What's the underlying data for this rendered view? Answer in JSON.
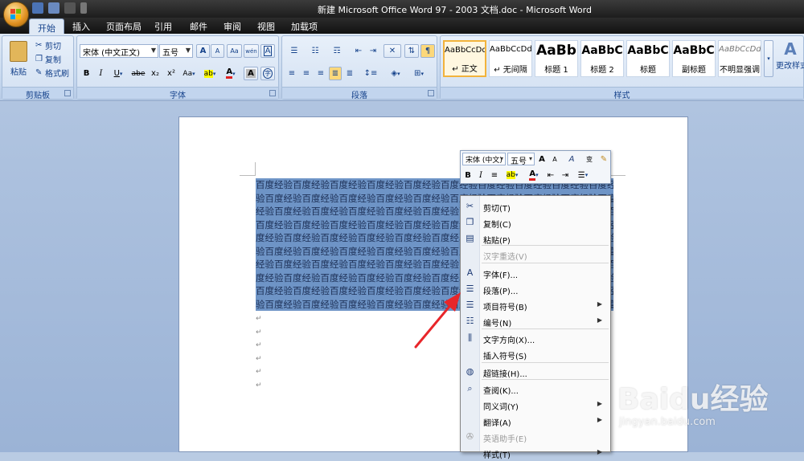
{
  "window": {
    "title": "新建 Microsoft Office Word 97 - 2003 文档.doc - Microsoft Word"
  },
  "tabs": [
    "开始",
    "插入",
    "页面布局",
    "引用",
    "邮件",
    "审阅",
    "视图",
    "加载项"
  ],
  "clipboard": {
    "paste": "粘贴",
    "cut": "剪切",
    "copy": "复制",
    "format_painter": "格式刷",
    "group": "剪贴板"
  },
  "font": {
    "name": "宋体 (中文正文)",
    "size": "五号",
    "group": "字体",
    "grow": "A",
    "shrink": "A",
    "clear": "Aa",
    "phonetic": "wén",
    "border_char": "A",
    "bold": "B",
    "italic": "I",
    "underline": "U",
    "strike": "abe",
    "subscript": "x₂",
    "superscript": "x²",
    "change_case": "Aa",
    "highlight": "ab",
    "font_color": "A",
    "char_shade": "A",
    "enclose": "字"
  },
  "paragraph": {
    "group": "段落"
  },
  "styles": {
    "group": "样式",
    "items": [
      {
        "preview": "AaBbCcDd",
        "name": "↵ 正文"
      },
      {
        "preview": "AaBbCcDd",
        "name": "↵ 无间隔"
      },
      {
        "preview": "AaBb",
        "name": "标题 1"
      },
      {
        "preview": "AaBbC",
        "name": "标题 2"
      },
      {
        "preview": "AaBbC",
        "name": "标题"
      },
      {
        "preview": "AaBbC",
        "name": "副标题"
      },
      {
        "preview": "AaBbCcDd",
        "name": "不明显强调"
      }
    ],
    "change_styles": "更改样式"
  },
  "document": {
    "lines": [
      "百度经验百度经验百度经验百度经验百度经验百度经验百度经验百度经验百度经验百度经验",
      "验百度经验百度经验百度经验百度经验百度经验百度经验百度经验百度经验百度经验百度经验",
      "经验百度经验百度经验百度经验百度经验百度经验百度经验百度经验百度经验百度经验百度",
      "百度经验百度经验百度经验百度经验百度经验百度经验百度经验百度经验百度经验百度经验",
      "度经验百度经验百度经验百度经验百度经验百度经验百度经验百度经验百度经验百度经验百",
      "验百度经验百度经验百度经验百度经验百度经验百度经验百度经验百度经验百度经验百度经",
      "经验百度经验百度经验百度经验百度经验百度经验百度经验百度经验百度经验百度经验百度",
      "度经验百度经验百度经验百度经验百度经验百度经验百度经验百度经验百度经验百度经验百",
      "百度经验百度经验百度经验百度经验百度经验百度经验百度经验百度经验百度经验百度经验",
      "验百度经验百度经验百度经验百度经验百度经验百度经验百度经验百度经验百度经验百度经"
    ],
    "empty_marks": [
      "↵",
      "↵",
      "↵",
      "↵",
      "↵",
      "↵"
    ]
  },
  "mini_toolbar": {
    "font": "宋体 (中文)",
    "size": "五号",
    "bold": "B",
    "italic": "I",
    "font_color": "A"
  },
  "context_menu": {
    "items": [
      {
        "label": "剪切(T)",
        "icon": "scissors-icon"
      },
      {
        "label": "复制(C)",
        "icon": "copy-icon"
      },
      {
        "label": "粘贴(P)",
        "icon": "paste-icon"
      },
      {
        "label": "汉字重选(V)",
        "icon": "",
        "disabled": true
      },
      {
        "label": "字体(F)...",
        "icon": "font-icon"
      },
      {
        "label": "段落(P)...",
        "icon": "paragraph-icon"
      },
      {
        "label": "项目符号(B)",
        "icon": "bullets-icon",
        "submenu": true
      },
      {
        "label": "编号(N)",
        "icon": "numbering-icon",
        "submenu": true
      },
      {
        "label": "文字方向(X)...",
        "icon": "text-direction-icon"
      },
      {
        "label": "插入符号(S)",
        "icon": ""
      },
      {
        "label": "超链接(H)...",
        "icon": "hyperlink-icon"
      },
      {
        "label": "查阅(K)...",
        "icon": "lookup-icon"
      },
      {
        "label": "同义词(Y)",
        "icon": "",
        "submenu": true
      },
      {
        "label": "翻译(A)",
        "icon": "",
        "submenu": true
      },
      {
        "label": "英语助手(E)",
        "icon": "assistant-icon",
        "disabled": true
      },
      {
        "label": "样式(T)",
        "icon": "",
        "submenu": true
      }
    ]
  },
  "watermark": {
    "logo": "Baidu经验",
    "url": "jingyan.baidu.com"
  }
}
